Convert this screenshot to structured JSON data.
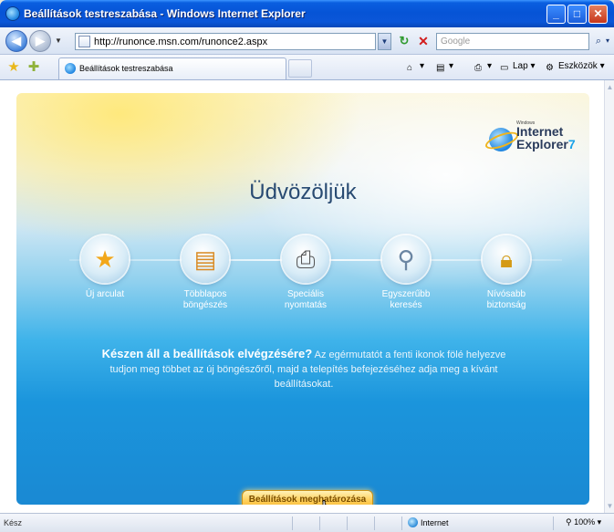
{
  "window": {
    "title": "Beállítások testreszabása - Windows Internet Explorer",
    "buttons": {
      "minimize": "_",
      "maximize": "□",
      "close": "✕"
    }
  },
  "address_bar": {
    "url": "http://runonce.msn.com/runonce2.aspx",
    "search_placeholder": "Google"
  },
  "tabs": [
    {
      "label": "Beállítások testreszabása"
    }
  ],
  "command_bar": {
    "page_label": "Lap",
    "tools_label": "Eszközök"
  },
  "content": {
    "logo": {
      "small": "Windows",
      "line1": "Internet",
      "line2": "Explorer",
      "version": "7"
    },
    "welcome": "Üdvözöljük",
    "features": [
      {
        "line1": "Új arculat",
        "line2": "",
        "icon": "star-icon"
      },
      {
        "line1": "Többlapos",
        "line2": "böngészés",
        "icon": "tabs-icon"
      },
      {
        "line1": "Speciális",
        "line2": "nyomtatás",
        "icon": "printer-icon"
      },
      {
        "line1": "Egyszerűbb",
        "line2": "keresés",
        "icon": "magnifier-icon"
      },
      {
        "line1": "Nívósabb",
        "line2": "biztonság",
        "icon": "padlock-icon"
      }
    ],
    "ready_bold": "Készen áll a beállítások elvégzésére?",
    "ready_text": "Az egérmutatót a fenti ikonok fölé helyezve tudjon meg többet az új böngészőről, majd a telepítés befejezéséhez adja meg a kívánt beállításokat.",
    "setup_button": "Beállítások meghatározása"
  },
  "status_bar": {
    "status": "Kész",
    "zone": "Internet",
    "zoom": "100%"
  },
  "colors": {
    "titlebar": "#0654d6",
    "accent_button": "#ffd15e",
    "panel_blue": "#1b95dc"
  }
}
